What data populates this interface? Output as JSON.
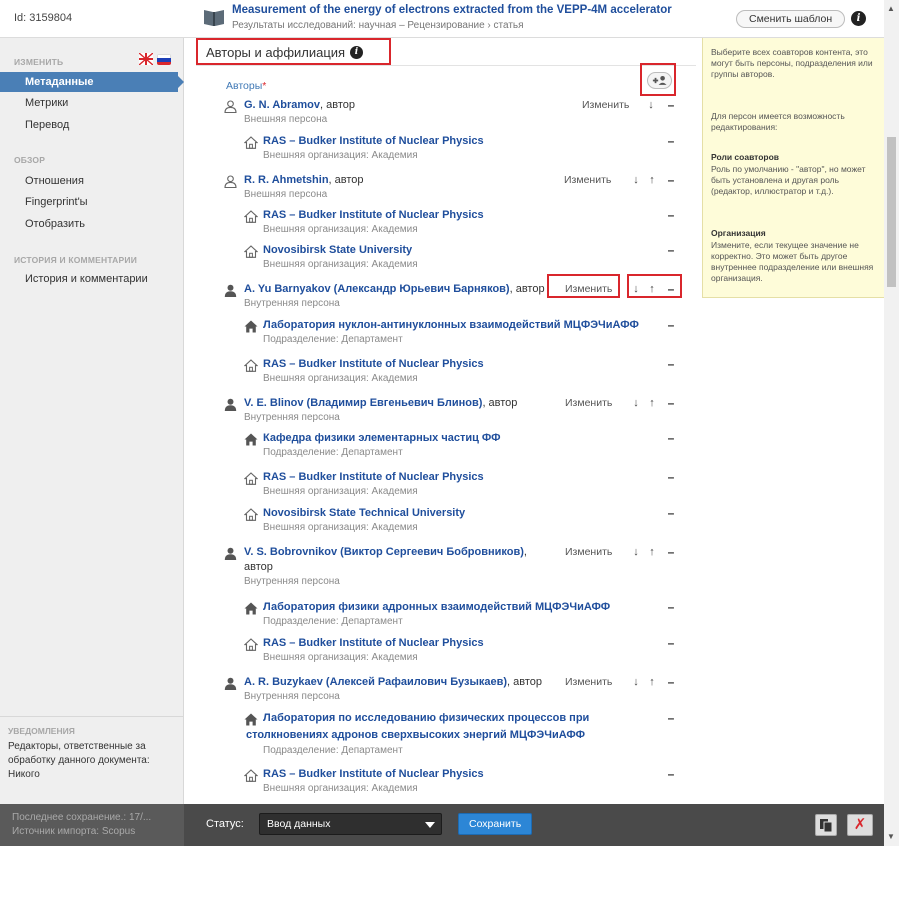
{
  "header": {
    "doc_id": "Id: 3159804",
    "title": "Measurement of the energy of electrons extracted from the VEPP-4M accelerator",
    "breadcrumb": "Результаты исследований: научная – Рецензирование › статья",
    "change_template": "Сменить шаблон"
  },
  "sidebar": {
    "edit_section": "ИЗМЕНИТЬ",
    "active_item": "Метаданные",
    "edit_items": [
      "Метрики",
      "Перевод"
    ],
    "overview_section": "ОБЗОР",
    "overview_items": [
      "Отношения",
      "Fingerprint'ы",
      "Отобразить"
    ],
    "history_section": "ИСТОРИЯ И КОММЕНТАРИИ",
    "history_items": [
      "История и комментарии"
    ],
    "notifications_title": "УВЕДОМЛЕНИЯ",
    "notifications_text": "Редакторы, ответственные за обработку данного документа: Никого"
  },
  "main": {
    "section_title": "Авторы и аффилиация",
    "authors_label": "Авторы",
    "required_mark": "*",
    "edit_label": "Изменить",
    "arrow_down": "↓",
    "arrow_up": "↑",
    "remove": "–",
    "role_suffix": ", автор",
    "authors": [
      {
        "name": "G. N. Abramov",
        "type": "Внешняя персона",
        "internal": false,
        "orgs": [
          {
            "name": "RAS – Budker Institute of Nuclear Physics",
            "sub": "Внешняя организация: Академия",
            "internal": false
          }
        ]
      },
      {
        "name": "R. R. Ahmetshin",
        "type": "Внешняя персона",
        "internal": false,
        "orgs": [
          {
            "name": "RAS – Budker Institute of Nuclear Physics",
            "sub": "Внешняя организация: Академия",
            "internal": false
          },
          {
            "name": "Novosibirsk State University",
            "sub": "Внешняя организация: Академия",
            "internal": false
          }
        ]
      },
      {
        "name": "A. Yu Barnyakov (Александр Юрьевич Барняков)",
        "type": "Внутренняя персона",
        "internal": true,
        "orgs": [
          {
            "name": "Лаборатория нуклон-антинуклонных взаимодействий МЦФЭЧиАФФ",
            "sub": "Подразделение: Департамент",
            "internal": true
          },
          {
            "name": "RAS – Budker Institute of Nuclear Physics",
            "sub": "Внешняя организация: Академия",
            "internal": false
          }
        ]
      },
      {
        "name": "V. E. Blinov (Владимир Евгеньевич Блинов)",
        "type": "Внутренняя персона",
        "internal": true,
        "orgs": [
          {
            "name": "Кафедра физики элементарных частиц ФФ",
            "sub": "Подразделение: Департамент",
            "internal": true
          },
          {
            "name": "RAS – Budker Institute of Nuclear Physics",
            "sub": "Внешняя организация: Академия",
            "internal": false
          },
          {
            "name": "Novosibirsk State Technical University",
            "sub": "Внешняя организация: Академия",
            "internal": false
          }
        ]
      },
      {
        "name": "V. S. Bobrovnikov (Виктор Сергеевич Бобровников)",
        "role_wrap": "автор",
        "type": "Внутренняя персона",
        "internal": true,
        "orgs": [
          {
            "name": "Лаборатория физики адронных взаимодействий МЦФЭЧиАФФ",
            "sub": "Подразделение: Департамент",
            "internal": true
          },
          {
            "name": "RAS – Budker Institute of Nuclear Physics",
            "sub": "Внешняя организация: Академия",
            "internal": false
          }
        ]
      },
      {
        "name": "A. R. Buzykaev (Алексей Рафаилович Бузыкаев)",
        "type": "Внутренняя персона",
        "internal": true,
        "orgs": [
          {
            "name": "Лаборатория по исследованию физических процессов при",
            "name2": "столкновениях адронов сверхвысоких энергий МЦФЭЧиАФФ",
            "sub": "Подразделение: Департамент",
            "internal": true
          },
          {
            "name": "RAS – Budker Institute of Nuclear Physics",
            "sub": "Внешняя организация: Академия",
            "internal": false
          }
        ]
      }
    ]
  },
  "help": {
    "intro": "Выберите всех соавторов контента, это могут быть персоны, подразделения или группы авторов.",
    "persons": "Для персон имеется возможность редактирования:",
    "roles_title": "Роли соавторов",
    "roles_text": "Роль по умолчанию - \"автор\", но может быть установлена и другая роль (редактор, иллюстратор и т.д.).",
    "org_title": "Организация",
    "org_text": "Измените, если текущее значение не корректно. Это может быть другое внутреннее подразделение или внешняя организация."
  },
  "footer": {
    "last_save": "Последнее сохранение.: 17/...",
    "import_source": "Источник импорта: Scopus",
    "status_label": "Статус:",
    "status_value": "Ввод данных",
    "save": "Сохранить",
    "close_glyph": "✗"
  },
  "colors": {
    "accent": "#4a7fb6",
    "link": "#1f4e9c",
    "highlight": "#d9262c",
    "help_bg": "#fefcd9"
  }
}
